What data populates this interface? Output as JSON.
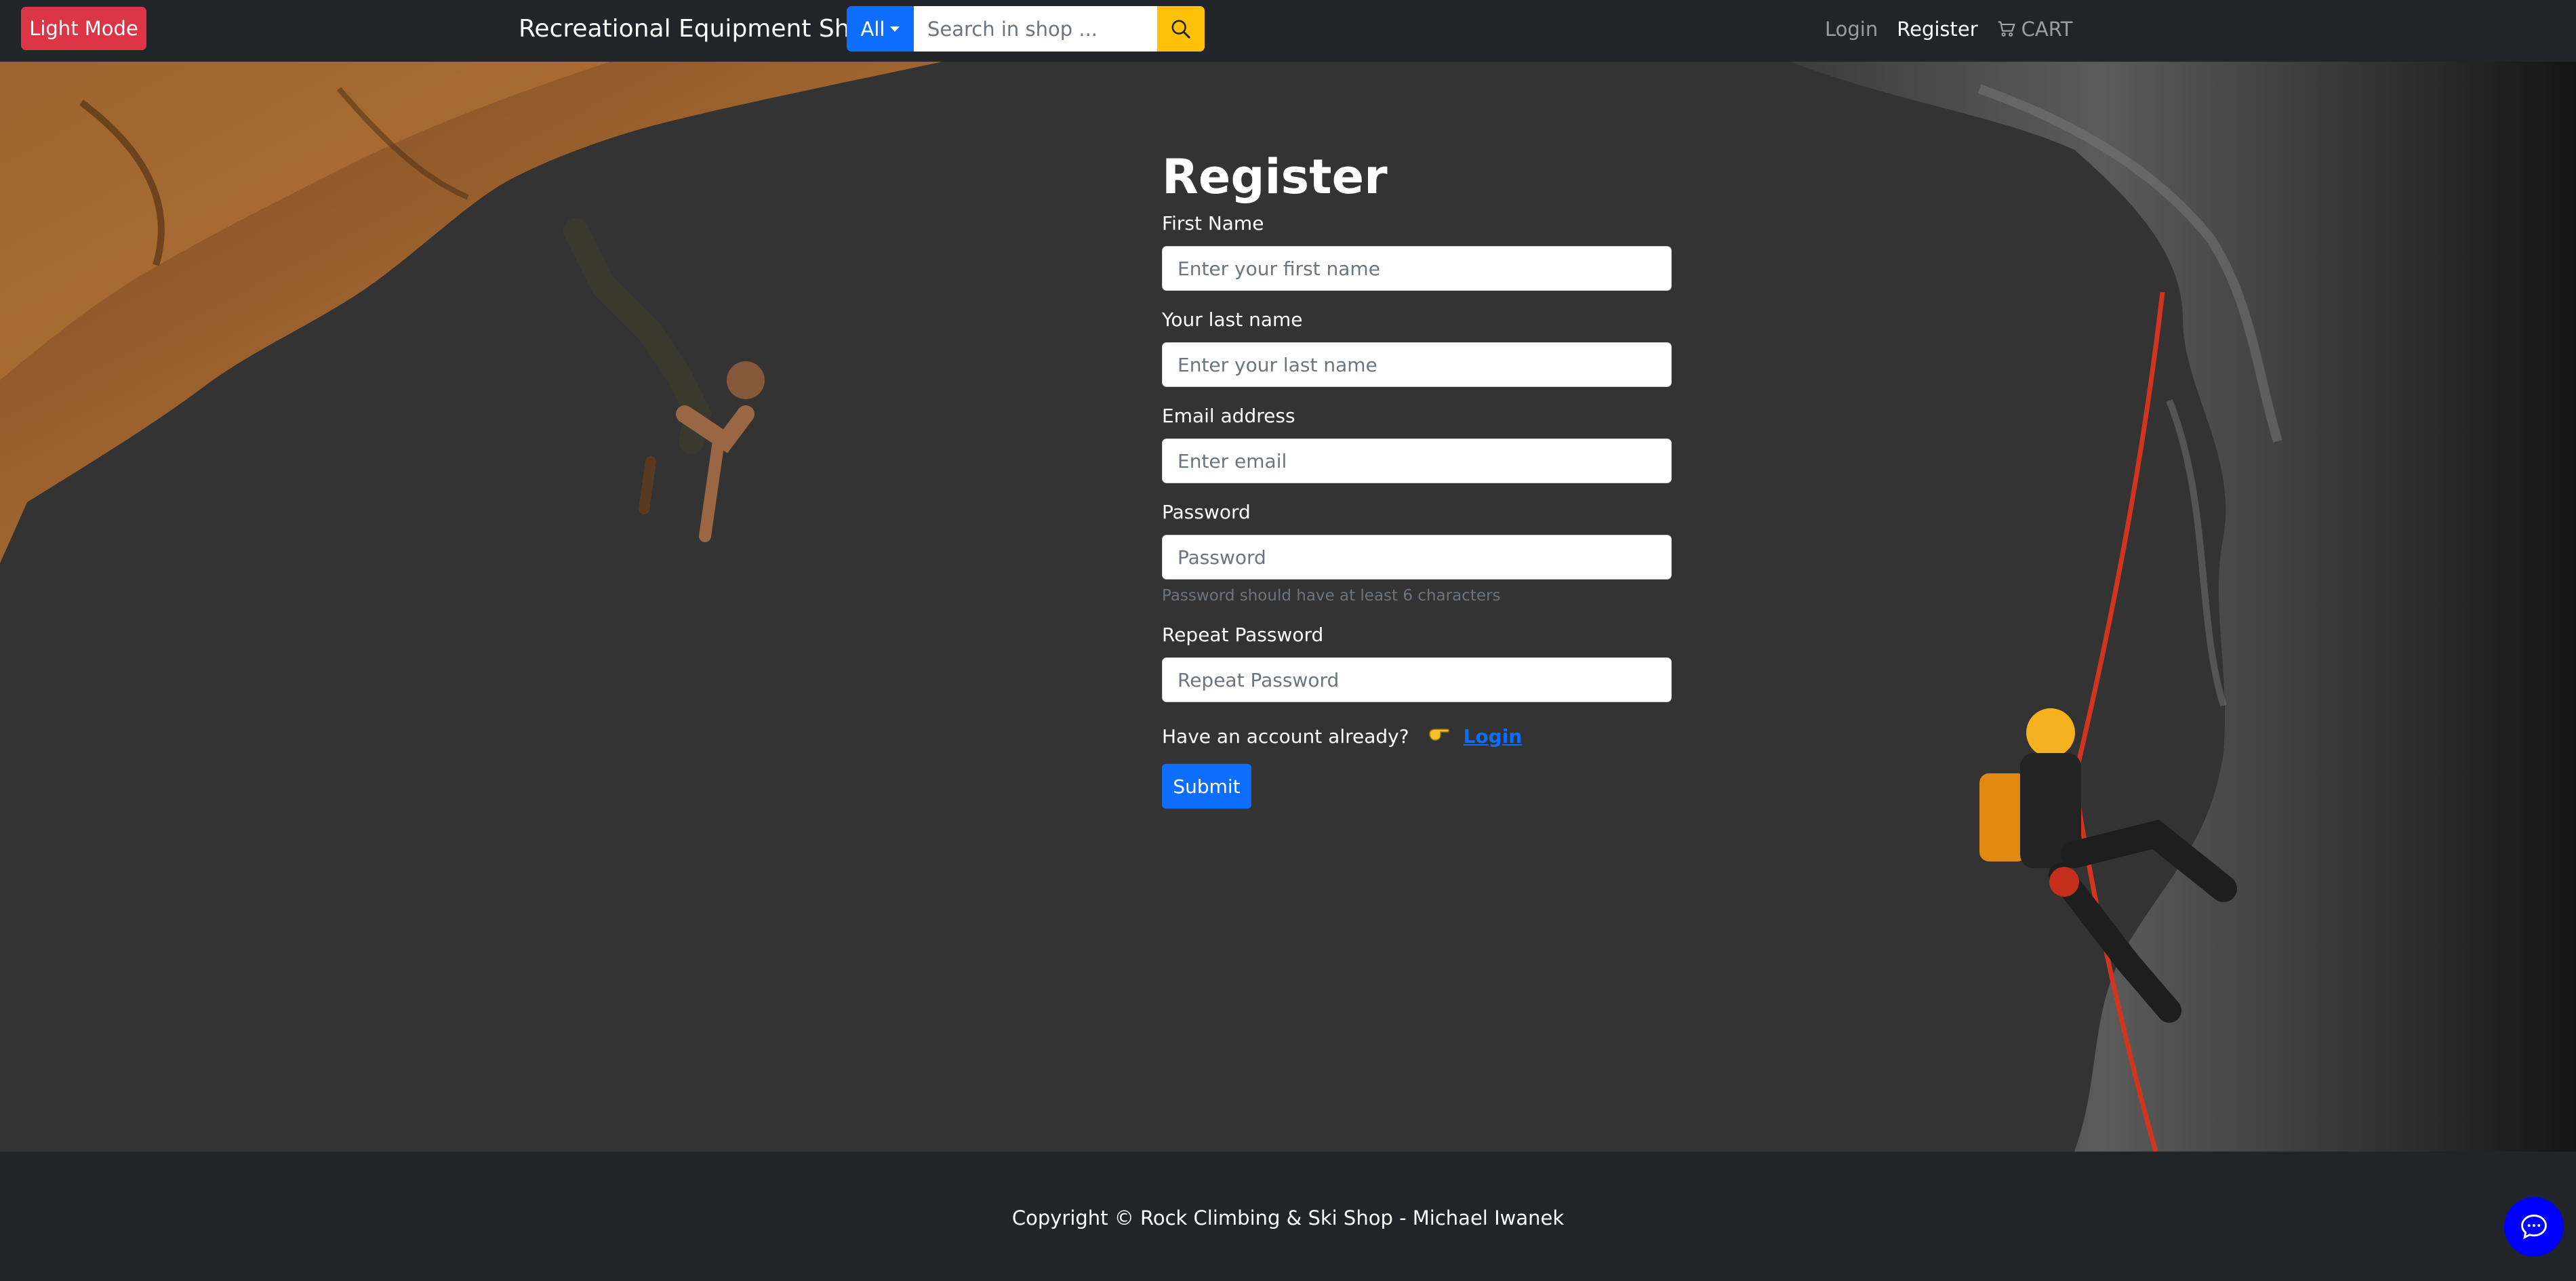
{
  "navbar": {
    "theme_toggle_label": "Light Mode",
    "brand": "Recreational Equipment Shop",
    "search": {
      "category_label": "All",
      "placeholder": "Search in shop ..."
    },
    "links": {
      "login": "Login",
      "register": "Register",
      "cart": "CART"
    }
  },
  "form": {
    "title": "Register",
    "first_name": {
      "label": "First Name",
      "placeholder": "Enter your first name"
    },
    "last_name": {
      "label": "Your last name",
      "placeholder": "Enter your last name"
    },
    "email": {
      "label": "Email address",
      "placeholder": "Enter email"
    },
    "password": {
      "label": "Password",
      "placeholder": "Password",
      "hint": "Password should have at least 6 characters"
    },
    "repeat_password": {
      "label": "Repeat Password",
      "placeholder": "Repeat Password"
    },
    "account_prompt": "Have an account already?",
    "login_link": "Login",
    "submit_label": "Submit"
  },
  "footer": {
    "copyright": "Copyright © Rock Climbing & Ski Shop - Michael Iwanek"
  },
  "colors": {
    "navbar_bg": "#212529",
    "page_bg": "#333333",
    "danger": "#dc3545",
    "primary": "#0d6efd",
    "warning": "#ffc107",
    "chat": "#0000ff"
  },
  "icons": {
    "search": "search-icon",
    "cart": "cart-icon",
    "pointer": "hand-pointing-right-icon",
    "chat": "chat-bubble-icon"
  }
}
